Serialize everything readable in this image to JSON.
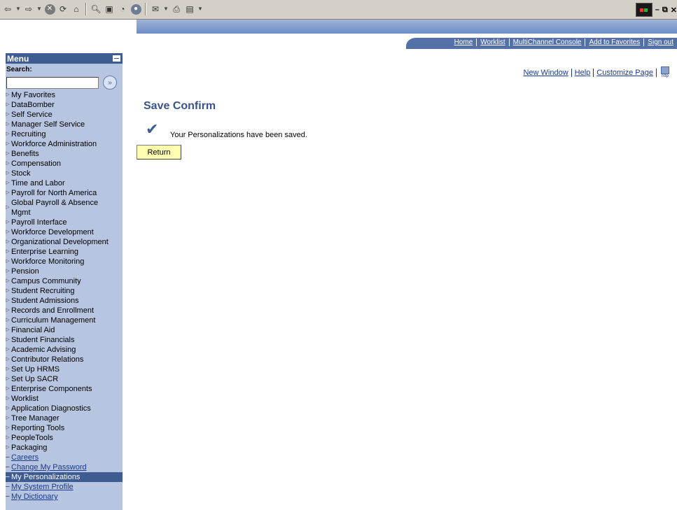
{
  "browser": {
    "toolbar_icons": [
      "back-arrow-icon",
      "back-dropdown-icon",
      "forward-arrow-icon",
      "forward-dropdown-icon",
      "stop-icon",
      "refresh-icon",
      "home-icon",
      "search-icon",
      "favorites-icon",
      "history-icon",
      "mail-icon",
      "mail-dropdown-icon",
      "print-icon",
      "edit-icon",
      "edit-dropdown-icon"
    ],
    "window_controls": [
      "minimize",
      "restore",
      "close"
    ]
  },
  "header": {
    "nav_links": [
      "Home",
      "Worklist",
      "MultiChannel Console",
      "Add to Favorites",
      "Sign out"
    ]
  },
  "menu": {
    "title": "Menu",
    "search_label": "Search:",
    "search_value": "",
    "items": [
      {
        "label": "My Favorites",
        "type": "folder"
      },
      {
        "label": "DataBomber",
        "type": "folder"
      },
      {
        "label": "Self Service",
        "type": "folder"
      },
      {
        "label": "Manager Self Service",
        "type": "folder"
      },
      {
        "label": "Recruiting",
        "type": "folder"
      },
      {
        "label": "Workforce Administration",
        "type": "folder"
      },
      {
        "label": "Benefits",
        "type": "folder"
      },
      {
        "label": "Compensation",
        "type": "folder"
      },
      {
        "label": "Stock",
        "type": "folder"
      },
      {
        "label": "Time and Labor",
        "type": "folder"
      },
      {
        "label": "Payroll for North America",
        "type": "folder"
      },
      {
        "label": "Global Payroll & Absence Mgmt",
        "type": "folder",
        "wrap": true
      },
      {
        "label": "Payroll Interface",
        "type": "folder"
      },
      {
        "label": "Workforce Development",
        "type": "folder"
      },
      {
        "label": "Organizational Development",
        "type": "folder"
      },
      {
        "label": "Enterprise Learning",
        "type": "folder"
      },
      {
        "label": "Workforce Monitoring",
        "type": "folder"
      },
      {
        "label": "Pension",
        "type": "folder"
      },
      {
        "label": "Campus Community",
        "type": "folder"
      },
      {
        "label": "Student Recruiting",
        "type": "folder"
      },
      {
        "label": "Student Admissions",
        "type": "folder"
      },
      {
        "label": "Records and Enrollment",
        "type": "folder"
      },
      {
        "label": "Curriculum Management",
        "type": "folder"
      },
      {
        "label": "Financial Aid",
        "type": "folder"
      },
      {
        "label": "Student Financials",
        "type": "folder"
      },
      {
        "label": "Academic Advising",
        "type": "folder"
      },
      {
        "label": "Contributor Relations",
        "type": "folder"
      },
      {
        "label": "Set Up HRMS",
        "type": "folder"
      },
      {
        "label": "Set Up SACR",
        "type": "folder"
      },
      {
        "label": "Enterprise Components",
        "type": "folder"
      },
      {
        "label": "Worklist",
        "type": "folder"
      },
      {
        "label": "Application Diagnostics",
        "type": "folder"
      },
      {
        "label": "Tree Manager",
        "type": "folder"
      },
      {
        "label": "Reporting Tools",
        "type": "folder"
      },
      {
        "label": "PeopleTools",
        "type": "folder"
      },
      {
        "label": "Packaging",
        "type": "folder"
      },
      {
        "label": "Careers",
        "type": "link"
      },
      {
        "label": "Change My Password",
        "type": "link"
      },
      {
        "label": "My Personalizations",
        "type": "selected"
      },
      {
        "label": "My System Profile",
        "type": "link"
      },
      {
        "label": "My Dictionary",
        "type": "link"
      }
    ]
  },
  "page_links": {
    "new_window": "New Window",
    "help": "Help",
    "customize_page": "Customize Page",
    "http_icon_text": "http"
  },
  "main": {
    "title": "Save Confirm",
    "message": "Your Personalizations have been saved.",
    "return_label": "Return"
  }
}
